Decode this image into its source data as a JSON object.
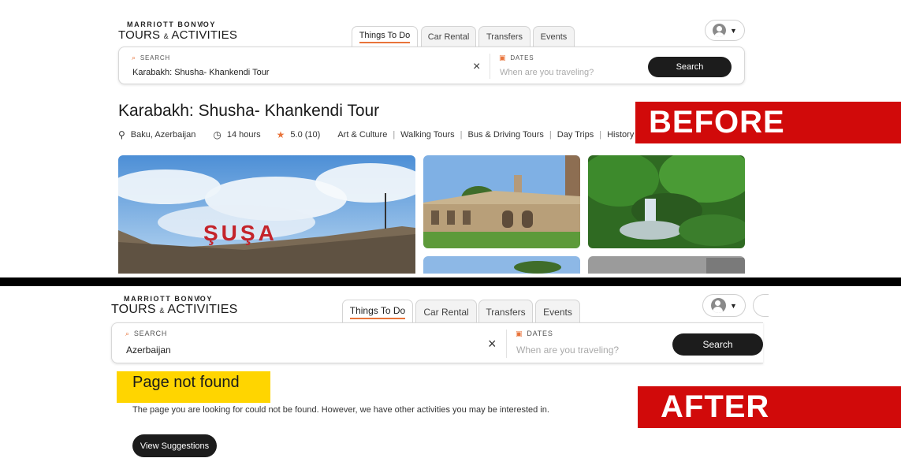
{
  "before": {
    "logo": {
      "brand": "MARRIOTT BONV̸OY",
      "product_left": "TOURS",
      "amp": "&",
      "product_right": "ACTIVITIES"
    },
    "tabs": [
      "Things To Do",
      "Car Rental",
      "Transfers",
      "Events"
    ],
    "search": {
      "label": "SEARCH",
      "value": "Karabakh: Shusha- Khankendi Tour",
      "dates_label": "DATES",
      "dates_placeholder": "When are you traveling?",
      "button": "Search"
    },
    "title": "Karabakh: Shusha- Khankendi Tour",
    "meta": {
      "location": "Baku, Azerbaijan",
      "duration": "14 hours",
      "rating": "5.0 (10)",
      "categories": [
        "Art & Culture",
        "Walking Tours",
        "Bus & Driving Tours",
        "Day Trips",
        "History"
      ]
    },
    "photo_sign": "ŞUŞA",
    "label": "BEFORE"
  },
  "after": {
    "logo": {
      "brand": "MARRIOTT BONV̸OY",
      "product_left": "TOURS",
      "amp": "&",
      "product_right": "ACTIVITIES"
    },
    "tabs": [
      "Things To Do",
      "Car Rental",
      "Transfers",
      "Events"
    ],
    "search": {
      "label": "SEARCH",
      "value": "Azerbaijan",
      "dates_label": "DATES",
      "dates_placeholder": "When are you traveling?",
      "button": "Search"
    },
    "heading": "Page not found",
    "message": "The page you are looking for could not be found. However, we have other activities you may be interested in.",
    "suggestions_button": "View Suggestions",
    "label": "AFTER"
  },
  "colors": {
    "accent": "#e8733a",
    "label_red": "#d10a0a",
    "highlight_yellow": "#ffd500",
    "button_dark": "#1c1c1c"
  }
}
